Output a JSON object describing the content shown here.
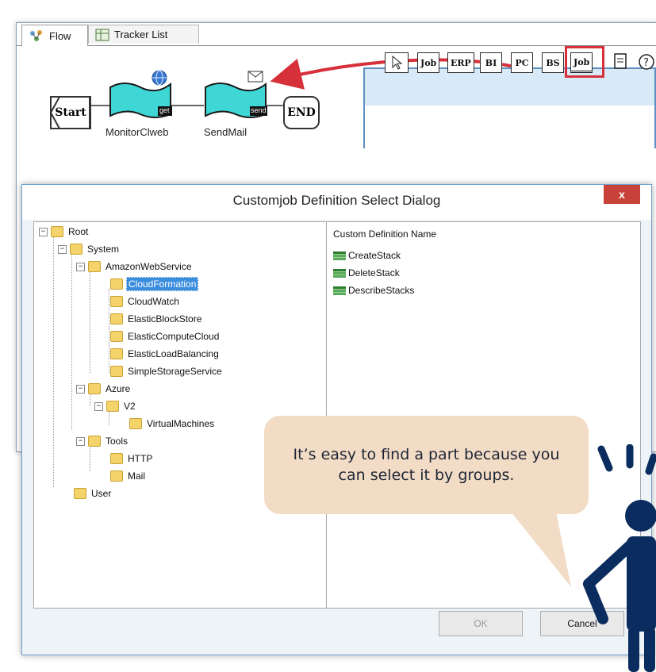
{
  "flow_window": {
    "tabs": [
      {
        "label": "Flow"
      },
      {
        "label": "Tracker List"
      }
    ],
    "nodes": {
      "start": "Start",
      "end": "END",
      "job1_label": "MonitorClweb",
      "job2_label": "SendMail",
      "job1_tag": "get",
      "job2_tag": "send"
    }
  },
  "toolbar": {
    "buttons": [
      "Job",
      "ERP",
      "BI",
      "PC",
      "BS",
      "Job"
    ]
  },
  "dialog": {
    "title": "Customjob Definition Select Dialog",
    "close": "x",
    "tree": {
      "root": "Root",
      "system": "System",
      "aws": "AmazonWebService",
      "aws_items": [
        "CloudFormation",
        "CloudWatch",
        "ElasticBlockStore",
        "ElasticComputeCloud",
        "ElasticLoadBalancing",
        "SimpleStorageService"
      ],
      "azure": "Azure",
      "v2": "V2",
      "vm": "VirtualMachines",
      "tools": "Tools",
      "tools_items": [
        "HTTP",
        "Mail"
      ],
      "user": "User"
    },
    "list": {
      "header": "Custom Definition Name",
      "items": [
        "CreateStack",
        "DeleteStack",
        "DescribeStacks"
      ]
    },
    "buttons": {
      "ok": "OK",
      "cancel": "Cancel"
    }
  },
  "callout": {
    "text": "It’s easy to find a part because you can select it by groups."
  },
  "colors": {
    "highlight_box": "#d6303a",
    "arrow": "#d6303a",
    "callout_bg": "#f3dcc5",
    "figure": "#0b2c5e",
    "selection": "#3b8ddd"
  }
}
